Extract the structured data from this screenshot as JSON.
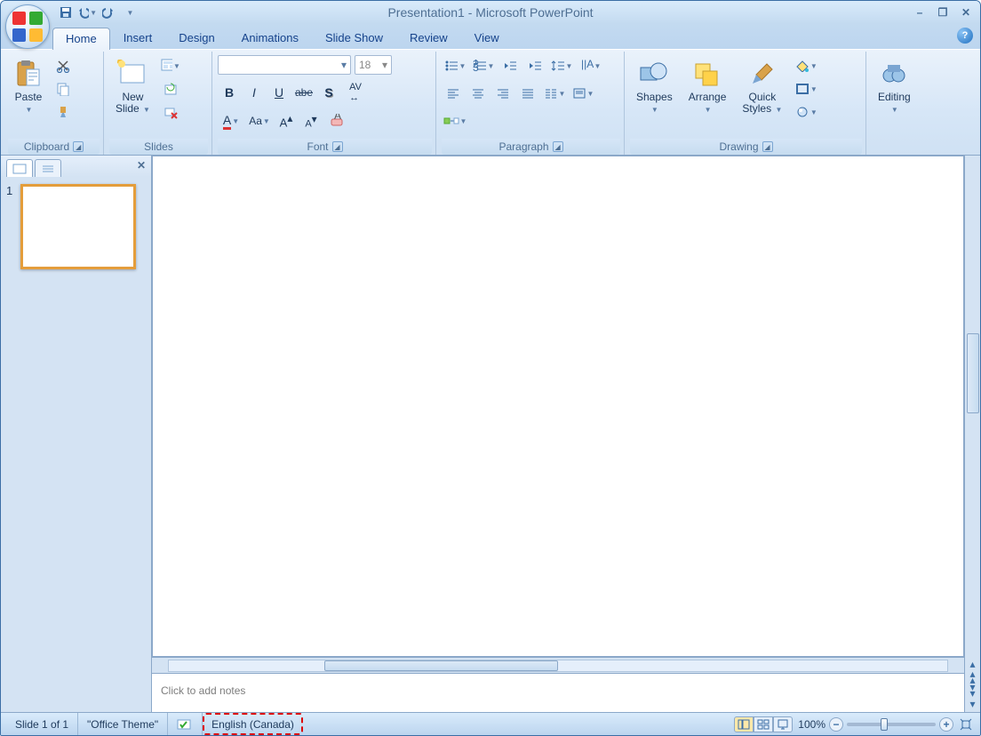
{
  "title": "Presentation1 - Microsoft PowerPoint",
  "qat": {
    "save": "save",
    "undo": "undo",
    "redo": "redo"
  },
  "tabs": [
    "Home",
    "Insert",
    "Design",
    "Animations",
    "Slide Show",
    "Review",
    "View"
  ],
  "active_tab": "Home",
  "ribbon": {
    "clipboard": {
      "label": "Clipboard",
      "paste": "Paste"
    },
    "slides": {
      "label": "Slides",
      "newslide": "New\nSlide"
    },
    "font": {
      "label": "Font",
      "font_name": "",
      "font_size": "18"
    },
    "paragraph": {
      "label": "Paragraph"
    },
    "drawing": {
      "label": "Drawing",
      "shapes": "Shapes",
      "arrange": "Arrange",
      "quickstyles": "Quick\nStyles"
    },
    "editing": {
      "label": "Editing",
      "editing": "Editing"
    }
  },
  "panel": {
    "slide_num": "1"
  },
  "notes_placeholder": "Click to add notes",
  "status": {
    "slide": "Slide 1 of 1",
    "theme": "\"Office Theme\"",
    "language": "English (Canada)",
    "zoom": "100%"
  }
}
